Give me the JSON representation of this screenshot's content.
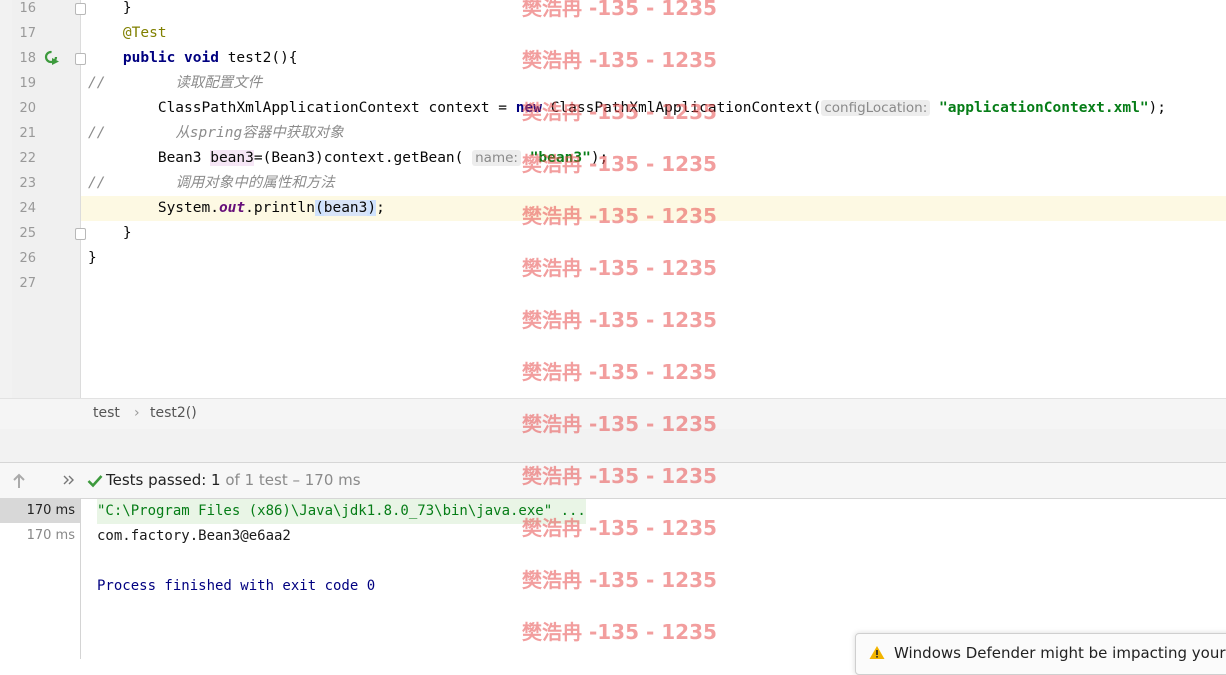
{
  "editor": {
    "lines": [
      {
        "num": "16",
        "segments": [
          {
            "t": "    }",
            "c": ""
          }
        ]
      },
      {
        "num": "17",
        "segments": [
          {
            "t": "    ",
            "c": ""
          },
          {
            "t": "@Test",
            "c": "ann"
          }
        ]
      },
      {
        "num": "18",
        "segments": [
          {
            "t": "    ",
            "c": ""
          },
          {
            "t": "public",
            "c": "kw"
          },
          {
            "t": " ",
            "c": ""
          },
          {
            "t": "void",
            "c": "kw"
          },
          {
            "t": " test2(){",
            "c": ""
          }
        ]
      },
      {
        "num": "19",
        "segments": [
          {
            "t": "//        ",
            "c": "cmt"
          },
          {
            "t": "读取配置文件",
            "c": "cmt"
          }
        ]
      },
      {
        "num": "20",
        "segments": [
          {
            "t": "        ClassPathXmlApplicationContext context = ",
            "c": ""
          },
          {
            "t": "new",
            "c": "kw"
          },
          {
            "t": " ClassPathXmlApplicationContext(",
            "c": ""
          },
          {
            "t": "configLocation:",
            "c": "hint"
          },
          {
            "t": " ",
            "c": ""
          },
          {
            "t": "\"applicationContext.xml\"",
            "c": "str"
          },
          {
            "t": ");",
            "c": ""
          }
        ]
      },
      {
        "num": "21",
        "segments": [
          {
            "t": "//        ",
            "c": "cmt"
          },
          {
            "t": "从spring容器中获取对象",
            "c": "cmt"
          }
        ]
      },
      {
        "num": "22",
        "segments": [
          {
            "t": "        Bean3 ",
            "c": ""
          },
          {
            "t": "bean3",
            "c": "varhl"
          },
          {
            "t": "=(Bean3)context.getBean( ",
            "c": ""
          },
          {
            "t": "name:",
            "c": "hint"
          },
          {
            "t": " ",
            "c": ""
          },
          {
            "t": "\"bean3\"",
            "c": "str"
          },
          {
            "t": ");",
            "c": ""
          }
        ]
      },
      {
        "num": "23",
        "segments": [
          {
            "t": "//        ",
            "c": "cmt"
          },
          {
            "t": "调用对象中的属性和方法",
            "c": "cmt"
          }
        ]
      },
      {
        "num": "24",
        "segments": [
          {
            "t": "        System.",
            "c": ""
          },
          {
            "t": "out",
            "c": "static"
          },
          {
            "t": ".println",
            "c": ""
          },
          {
            "t": "(",
            "c": "parhl"
          },
          {
            "t": "bean3",
            "c": "selhl"
          },
          {
            "t": ")",
            "c": "parhl"
          },
          {
            "t": ";",
            "c": ""
          }
        ]
      },
      {
        "num": "25",
        "segments": [
          {
            "t": "    }",
            "c": ""
          }
        ]
      },
      {
        "num": "26",
        "segments": [
          {
            "t": "}",
            "c": ""
          }
        ]
      },
      {
        "num": "27",
        "segments": []
      }
    ],
    "current_line": "24"
  },
  "breadcrumb": {
    "class_name": "test",
    "separator": "›",
    "method_name": "test2()"
  },
  "tests": {
    "status_prefix": "Tests passed: ",
    "passed_count": "1",
    "status_suffix": " of 1 test – 170 ms"
  },
  "console": {
    "times": [
      "170 ms",
      "170 ms"
    ],
    "lines": [
      {
        "text": "\"C:\\Program Files (x86)\\Java\\jdk1.8.0_73\\bin\\java.exe\" ...",
        "style": "cmd"
      },
      {
        "text": "com.factory.Bean3@e6aa2",
        "style": "out"
      },
      {
        "text": "",
        "style": "out"
      },
      {
        "text": "Process finished with exit code 0",
        "style": "sys"
      }
    ]
  },
  "watermark": {
    "text": "樊浩冉 -135 - 1235",
    "count": 13
  },
  "notification": {
    "text": "Windows Defender might be impacting your"
  },
  "colors": {
    "keyword": "#000080",
    "string": "#067d17",
    "annotation": "#808000",
    "comment": "#8c8c8c",
    "success": "#3d9a3d",
    "watermark": "#e84e4e"
  }
}
